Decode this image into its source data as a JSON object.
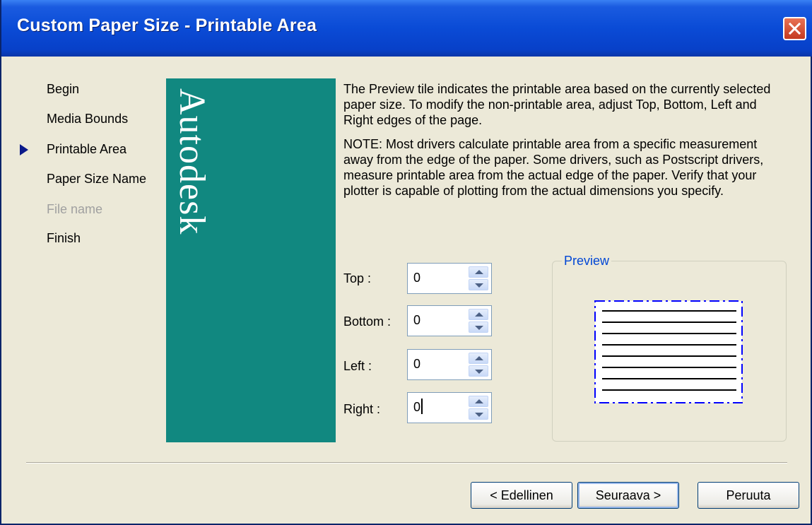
{
  "window": {
    "title": "Custom Paper Size - Printable Area",
    "close_icon": "close-icon"
  },
  "steps": [
    {
      "label": "Begin",
      "state": "enabled"
    },
    {
      "label": "Media Bounds",
      "state": "enabled"
    },
    {
      "label": "Printable Area",
      "state": "current"
    },
    {
      "label": "Paper Size Name",
      "state": "enabled"
    },
    {
      "label": "File name",
      "state": "disabled"
    },
    {
      "label": "Finish",
      "state": "enabled"
    }
  ],
  "brand": {
    "text": "Autodesk",
    "color": "#118880"
  },
  "description": {
    "paragraph1": "The Preview tile indicates the printable area based on the currently selected paper size. To modify the non-printable area, adjust Top, Bottom, Left and Right edges of the page.",
    "paragraph2": "NOTE: Most drivers calculate printable area from a specific measurement away from the edge of the paper. Some drivers, such as Postscript drivers, measure printable area from the actual edge of the paper. Verify that your plotter is capable of plotting from the actual dimensions you specify."
  },
  "fields": {
    "top": {
      "label": "Top :",
      "value": "0"
    },
    "bottom": {
      "label": "Bottom :",
      "value": "0"
    },
    "left": {
      "label": "Left :",
      "value": "0"
    },
    "right": {
      "label": "Right :",
      "value": "0"
    }
  },
  "preview": {
    "legend": "Preview",
    "line_count": 8,
    "border_color": "#0000FF"
  },
  "buttons": {
    "back": "< Edellinen",
    "next": "Seuraava >",
    "cancel": "Peruuta"
  }
}
